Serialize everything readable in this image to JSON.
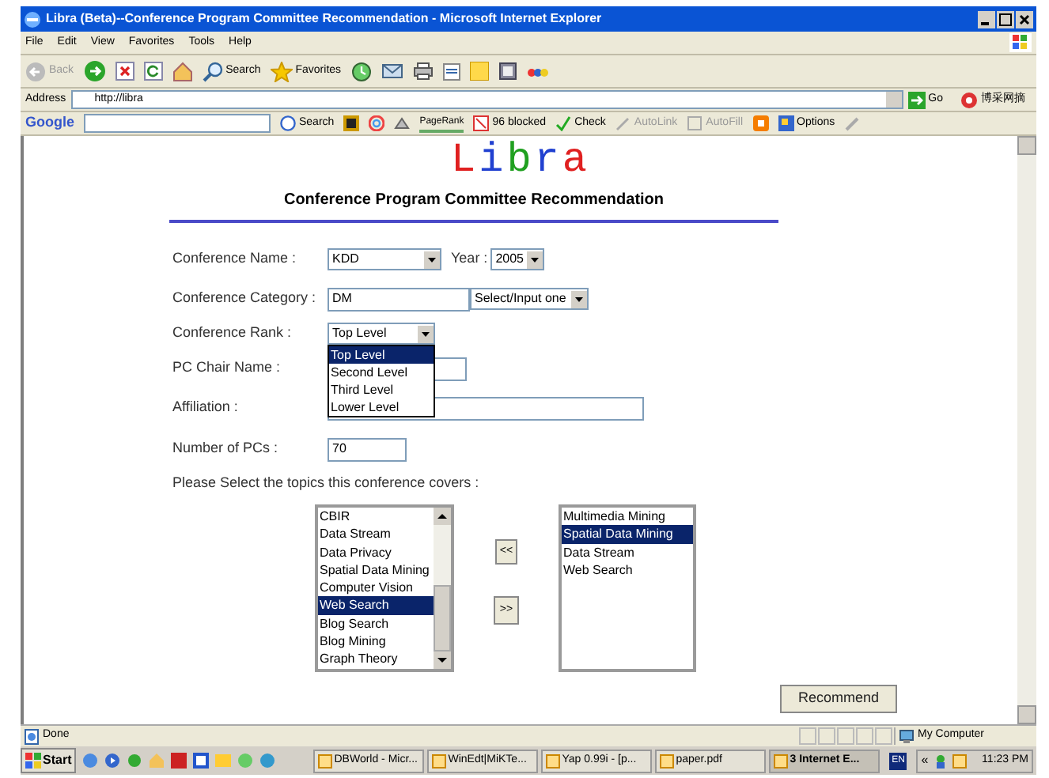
{
  "window": {
    "title": "Libra (Beta)--Conference Program Committee Recommendation - Microsoft Internet Explorer"
  },
  "menu": [
    "File",
    "Edit",
    "View",
    "Favorites",
    "Tools",
    "Help"
  ],
  "toolbar": {
    "back": "Back",
    "search": "Search",
    "favorites": "Favorites"
  },
  "address_bar": {
    "label": "Address",
    "url": "http://libra",
    "go": "Go",
    "extra": "博采网摘"
  },
  "google_bar": {
    "brand": "Google",
    "search": "Search",
    "pagerank": "PageRank",
    "blocked": "96 blocked",
    "check": "Check",
    "autolink": "AutoLink",
    "autofill": "AutoFill",
    "options": "Options"
  },
  "page": {
    "logo": [
      {
        "char": "L",
        "color": "#e02020"
      },
      {
        "char": "i",
        "color": "#2040d0"
      },
      {
        "char": "b",
        "color": "#20a020"
      },
      {
        "char": "r",
        "color": "#2040d0"
      },
      {
        "char": "a",
        "color": "#e02020"
      }
    ],
    "heading": "Conference Program Committee Recommendation",
    "conference_name": {
      "label": "Conference Name :",
      "value": "KDD"
    },
    "year": {
      "label": "Year :",
      "value": "2005"
    },
    "category": {
      "label": "Conference Category :",
      "value": "DM",
      "select": "Select/Input one"
    },
    "rank": {
      "label": "Conference Rank :",
      "value": "Top Level",
      "expanded": true,
      "options": [
        {
          "label": "Top Level",
          "selected": true
        },
        {
          "label": "Second Level",
          "selected": false
        },
        {
          "label": "Third Level",
          "selected": false
        },
        {
          "label": "Lower Level",
          "selected": false
        }
      ]
    },
    "pc_chair": {
      "label": "PC Chair Name :"
    },
    "affiliation": {
      "label": "Affiliation :"
    },
    "num_pcs": {
      "label": "Number of PCs :",
      "value": "70"
    },
    "topics_label": "Please Select the topics this conference covers :",
    "available_topics": [
      {
        "label": "CBIR",
        "selected": false
      },
      {
        "label": "Data Stream",
        "selected": false
      },
      {
        "label": "Data Privacy",
        "selected": false
      },
      {
        "label": "Spatial Data Mining",
        "selected": false
      },
      {
        "label": "Computer Vision",
        "selected": false
      },
      {
        "label": "Web Search",
        "selected": true
      },
      {
        "label": "Blog Search",
        "selected": false
      },
      {
        "label": "Blog Mining",
        "selected": false
      },
      {
        "label": "Graph Theory",
        "selected": false
      }
    ],
    "add_button": "<<",
    "remove_button": ">>",
    "chosen_topics": [
      {
        "label": "Multimedia Mining",
        "selected": false
      },
      {
        "label": "Spatial Data Mining",
        "selected": true
      },
      {
        "label": "Data Stream",
        "selected": false
      },
      {
        "label": "Web Search",
        "selected": false
      }
    ],
    "submit": "Recommend"
  },
  "status_bar": {
    "text": "Done",
    "zone": "My Computer"
  },
  "taskbar": {
    "start": "Start",
    "tasks": [
      {
        "label": "DBWorld - Micr...",
        "selected": false
      },
      {
        "label": "WinEdt|MiKTe...",
        "selected": false
      },
      {
        "label": "Yap 0.99i - [p...",
        "selected": false
      },
      {
        "label": "paper.pdf",
        "selected": false
      },
      {
        "label": "3 Internet E...",
        "selected": true
      }
    ],
    "language": "EN",
    "chevron": "«",
    "clock": "11:23 PM"
  }
}
